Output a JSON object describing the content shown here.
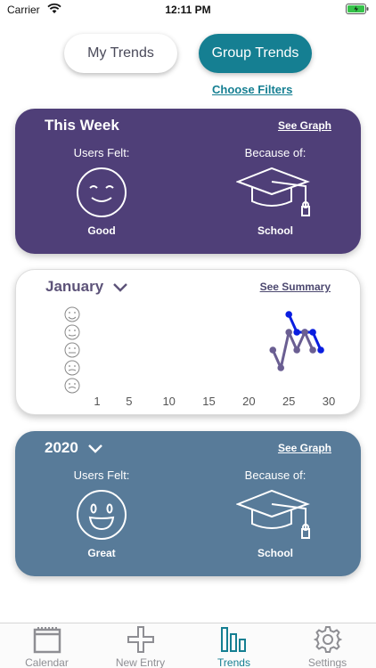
{
  "status_bar": {
    "carrier": "Carrier",
    "time": "12:11 PM"
  },
  "segments": {
    "my_trends": "My Trends",
    "group_trends": "Group Trends",
    "selected": "Group Trends"
  },
  "choose_filters": "Choose Filters",
  "week_card": {
    "title": "This Week",
    "link": "See Graph",
    "left_label": "Users Felt:",
    "right_label": "Because of:",
    "mood": "Good",
    "reason": "School",
    "mood_icon": "content-face-icon",
    "reason_icon": "graduation-cap-icon",
    "color": "#4f3f78"
  },
  "month_card": {
    "title": "January",
    "link": "See Summary",
    "mood_scale_icons": [
      "great-face-icon",
      "good-face-icon",
      "okay-face-icon",
      "bad-face-icon",
      "awful-face-icon"
    ]
  },
  "chart_data": {
    "type": "line",
    "x_ticks": [
      "1",
      "5",
      "10",
      "15",
      "20",
      "25",
      "30"
    ],
    "xlim": [
      1,
      30
    ],
    "ylim": [
      1,
      5
    ],
    "series": [
      {
        "color": "#0a1ee0",
        "points": [
          [
            25,
            5
          ],
          [
            26,
            4
          ],
          [
            27,
            4
          ],
          [
            28,
            4
          ],
          [
            29,
            3
          ]
        ]
      },
      {
        "color": "#6a5e92",
        "points": [
          [
            23,
            3
          ],
          [
            24,
            2
          ],
          [
            25,
            4
          ],
          [
            26,
            3
          ],
          [
            27,
            4
          ],
          [
            28,
            3
          ]
        ]
      }
    ]
  },
  "year_card": {
    "title": "2020",
    "link": "See Graph",
    "left_label": "Users Felt:",
    "right_label": "Because of:",
    "mood": "Great",
    "reason": "School",
    "mood_icon": "happy-face-icon",
    "reason_icon": "graduation-cap-icon",
    "color": "#587b99"
  },
  "tabs": [
    {
      "label": "Calendar",
      "icon": "calendar-icon"
    },
    {
      "label": "New Entry",
      "icon": "plus-icon"
    },
    {
      "label": "Trends",
      "icon": "bar-chart-icon"
    },
    {
      "label": "Settings",
      "icon": "gear-icon"
    }
  ],
  "active_tab": "Trends"
}
